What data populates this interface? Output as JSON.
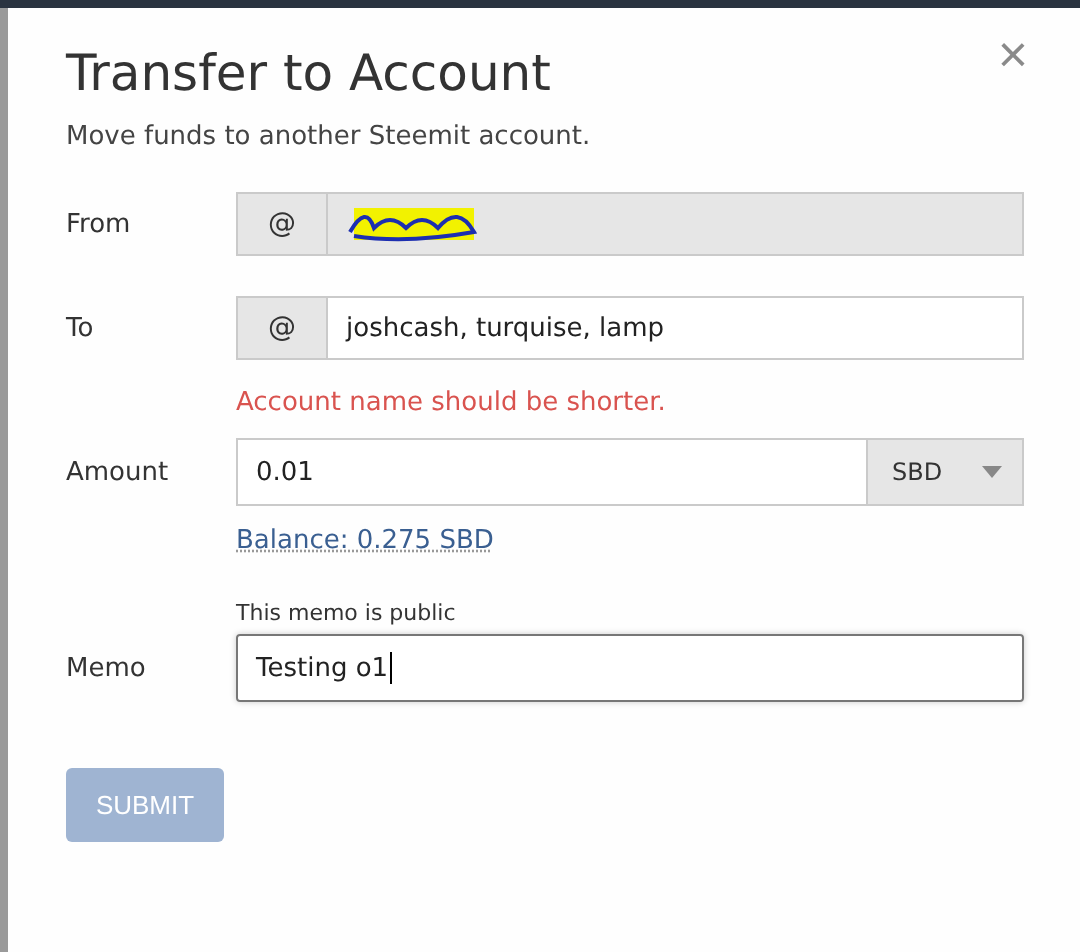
{
  "dialog": {
    "title": "Transfer to Account",
    "close": "×",
    "subtitle": "Move funds to another Steemit account."
  },
  "from": {
    "label": "From",
    "prefix": "@",
    "disabled": true,
    "redacted": true
  },
  "to": {
    "label": "To",
    "prefix": "@",
    "value": "joshcash, turquise, lamp",
    "disabled": false,
    "error": "Account name should be shorter."
  },
  "amount": {
    "label": "Amount",
    "value": "0.01",
    "asset": "SBD",
    "balance": "Balance: 0.275 SBD"
  },
  "memo": {
    "label": "Memo",
    "hint": "This memo is public",
    "value": "Testing o1",
    "focused": true
  },
  "submit": {
    "label": "SUBMIT",
    "disabled": true
  }
}
